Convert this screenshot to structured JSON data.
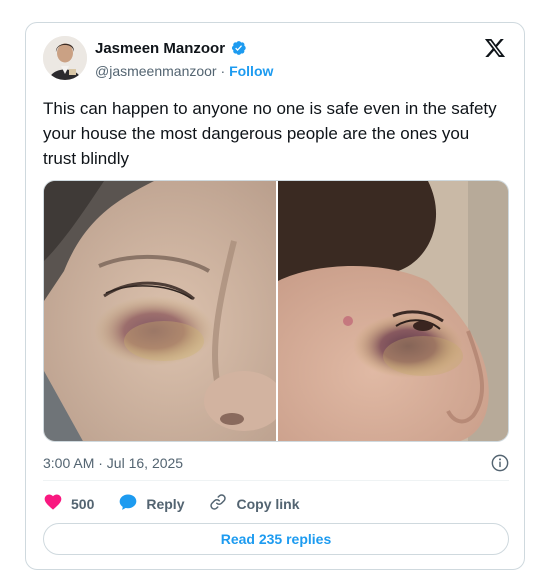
{
  "author": {
    "name": "Jasmeen Manzoor",
    "handle": "@jasmeenmanzoor",
    "separator": "·",
    "follow_label": "Follow"
  },
  "tweet": {
    "text": "This can happen to anyone no one is safe even in the safety your house the most dangerous people are the ones you trust blindly",
    "timestamp": "3:00 AM · Jul 16, 2025"
  },
  "actions": {
    "like_count": "500",
    "reply_label": "Reply",
    "copy_link_label": "Copy link"
  },
  "read_replies_label": "Read 235 replies",
  "icons": {
    "verified": "verified-badge-icon",
    "x_logo": "x-logo-icon",
    "info": "info-icon",
    "heart": "heart-icon",
    "reply": "reply-bubble-icon",
    "link": "link-icon"
  },
  "colors": {
    "accent": "#1d9bf0",
    "like": "#f91880",
    "text": "#0f1419",
    "muted": "#536471",
    "border": "#cfd9de"
  }
}
